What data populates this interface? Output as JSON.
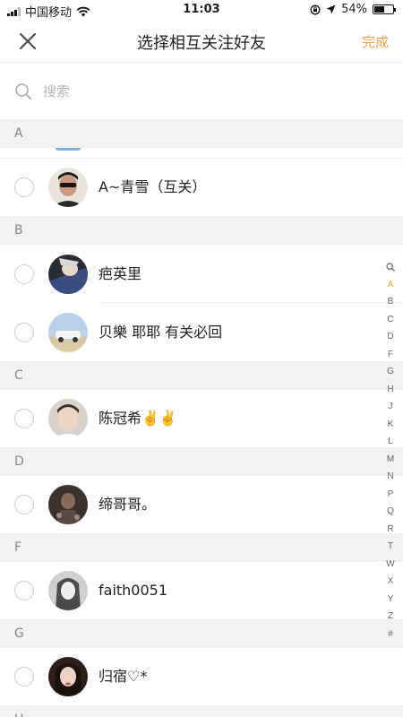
{
  "status_bar": {
    "carrier": "中国移动",
    "time": "11:03",
    "battery": "54%",
    "battery_level": 0.54
  },
  "nav": {
    "title": "选择相互关注好友",
    "done_label": "完成",
    "close_icon": "close-icon"
  },
  "search": {
    "placeholder": "搜索",
    "value": ""
  },
  "sections": [
    {
      "letter": "A",
      "contacts": [
        {
          "name": "A~青雪（互关）"
        }
      ]
    },
    {
      "letter": "B",
      "contacts": [
        {
          "name": "疤英里"
        },
        {
          "name": "贝樂   耶耶 有关必回"
        }
      ]
    },
    {
      "letter": "C",
      "contacts": [
        {
          "name": "陈冠希✌️✌️"
        }
      ]
    },
    {
      "letter": "D",
      "contacts": [
        {
          "name": "缔哥哥。"
        }
      ]
    },
    {
      "letter": "F",
      "contacts": [
        {
          "name": "faith0051"
        }
      ]
    },
    {
      "letter": "G",
      "contacts": [
        {
          "name": "归宿♡*"
        }
      ]
    },
    {
      "letter": "H",
      "contacts": []
    }
  ],
  "index_bar": {
    "letters": [
      "A",
      "B",
      "C",
      "D",
      "F",
      "G",
      "H",
      "J",
      "K",
      "L",
      "M",
      "N",
      "P",
      "Q",
      "R",
      "T",
      "W",
      "X",
      "Y",
      "Z",
      "#"
    ],
    "active": "A"
  },
  "colors": {
    "accent": "#f5a44a",
    "section_bg": "#f2f2f2"
  }
}
